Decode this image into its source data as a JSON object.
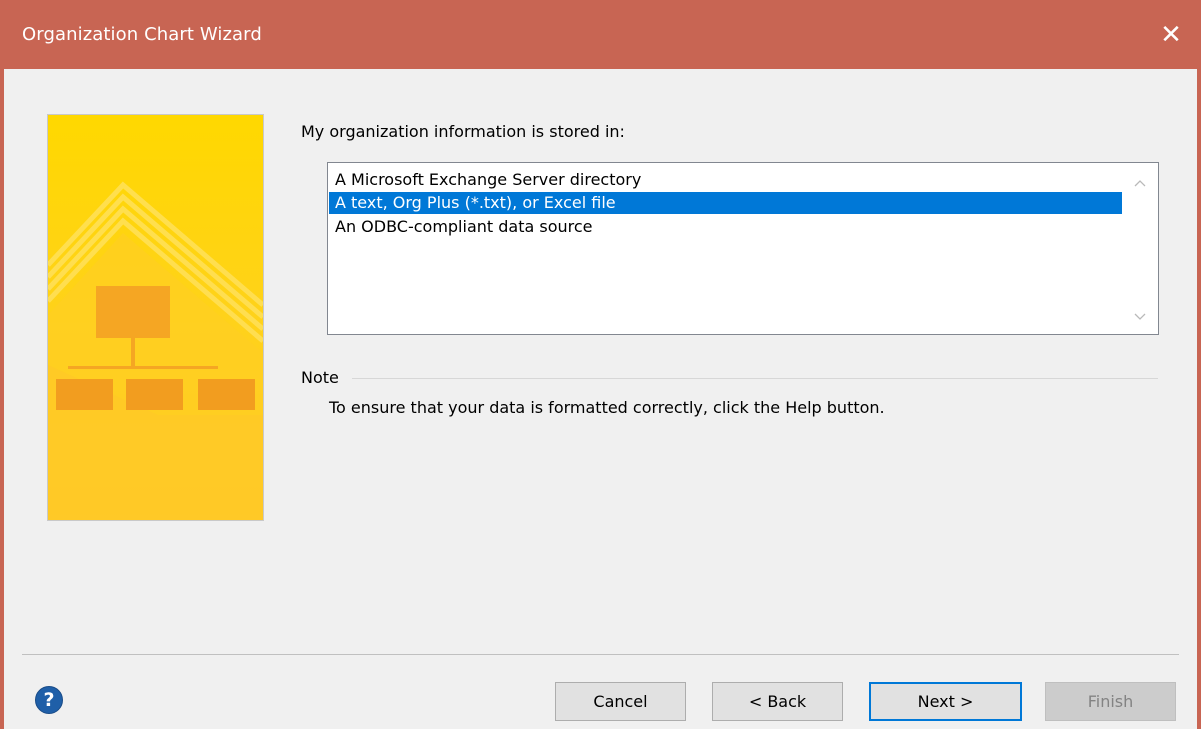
{
  "window": {
    "title": "Organization Chart Wizard",
    "close_glyph": "✕"
  },
  "main": {
    "prompt": "My organization information is stored in:",
    "options": [
      "A Microsoft Exchange Server directory",
      "A text, Org Plus (*.txt), or Excel file",
      "An ODBC-compliant data source"
    ],
    "selected_option": "A text, Org Plus (*.txt), or Excel file",
    "note_heading": "Note",
    "note_text": "To ensure that your data is formatted correctly, click the Help button."
  },
  "footer": {
    "help_glyph": "?",
    "cancel_label": "Cancel",
    "back_label": "< Back",
    "next_label": "Next >",
    "finish_label": "Finish"
  },
  "icons": {
    "close": "close-icon",
    "help": "help-icon",
    "scroll_up": "chevron-up-icon",
    "scroll_down": "chevron-down-icon"
  },
  "colors": {
    "titlebar": "#c86553",
    "selection": "#0078d7",
    "art_yellow": "#ffd21a",
    "art_orange": "#f4a320"
  }
}
